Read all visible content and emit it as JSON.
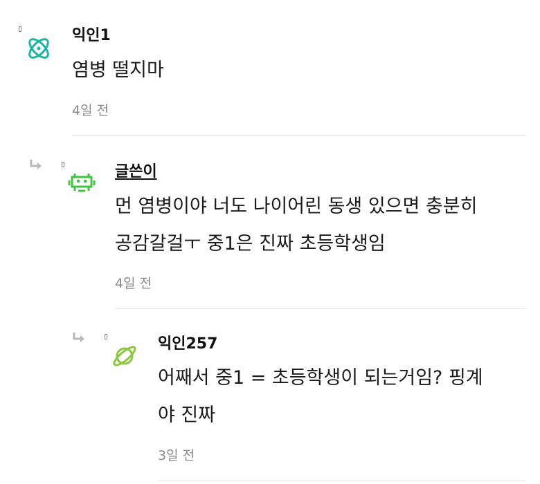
{
  "comments": [
    {
      "author": "익인1",
      "avatar_icon": "atom-icon",
      "avatar_color": "#1ab6a4",
      "lines": [
        "염병 떨지마"
      ],
      "time": "4일 전"
    },
    {
      "author": "글쓴이",
      "avatar_icon": "space-invader-icon",
      "avatar_color": "#3ec63e",
      "lines": [
        "먼 염병이야 너도 나이어린 동생 있으면 충분히",
        "공감갈걸ㅜ 중1은 진짜 초등학생임"
      ],
      "time": "4일 전"
    },
    {
      "author": "익인257",
      "avatar_icon": "planet-icon",
      "avatar_color": "#8cc63e",
      "lines": [
        "어째서 중1 = 초등학생이 되는거임? 핑계",
        "야 진짜"
      ],
      "time": "3일 전"
    }
  ]
}
